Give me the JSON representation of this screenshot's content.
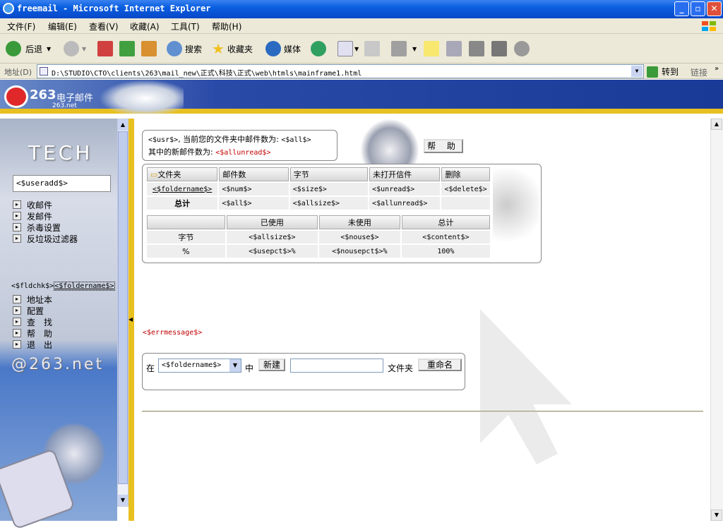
{
  "window": {
    "title": "freemail - Microsoft Internet Explorer"
  },
  "menu": [
    "文件(F)",
    "编辑(E)",
    "查看(V)",
    "收藏(A)",
    "工具(T)",
    "帮助(H)"
  ],
  "toolbar": {
    "back": "后退",
    "search": "搜索",
    "favorites": "收藏夹",
    "media": "媒体"
  },
  "address": {
    "label": "地址(D)",
    "url": "D:\\STUDIO\\CTO\\clients\\263\\mail_new\\正式\\科技\\正式\\web\\htmls\\mainframe1.html",
    "go": "转到",
    "links": "链接"
  },
  "brand": {
    "name": "263",
    "sub": "电子邮件",
    "site": "263.net"
  },
  "left": {
    "tech": "TECH",
    "useradd": "<$useradd$>",
    "nav1": [
      "收邮件",
      "发邮件",
      "杀毒设置",
      "反垃圾过滤器"
    ],
    "fldchk": "<$fldchk$>",
    "foldername": "<$foldername$>",
    "nav2": [
      "地址本",
      "配置",
      "查　找",
      "帮　助",
      "退　出"
    ],
    "footer": "@263.net"
  },
  "info": {
    "line1_var": "<$usr$>",
    "line1_text": ", 当前您的文件夹中邮件数为: ",
    "line1_all": "<$all$>",
    "line2_text": "其中的新邮件数为: ",
    "line2_unread": "<$allunread$>",
    "help": "帮 助"
  },
  "table1": {
    "headers": [
      "文件夹",
      "邮件数",
      "字节",
      "未打开信件",
      "删除"
    ],
    "row": [
      "<$foldername$>",
      "<$num$>",
      "<$size$>",
      "<$unread$>",
      "<$delete$>"
    ],
    "total": [
      "总计",
      "<$all$>",
      "<$allsize$>",
      "<$allunread$>",
      ""
    ]
  },
  "table2": {
    "headers": [
      "",
      "已使用",
      "未使用",
      "总计"
    ],
    "rows": [
      [
        "字节",
        "<$allsize$>",
        "<$nouse$>",
        "<$content$>"
      ],
      [
        "%",
        "<$usepct$>%",
        "<$nousepct$>%",
        "100%"
      ]
    ]
  },
  "errmessage": "<$errmessage$>",
  "folderform": {
    "in": "在",
    "select": "<$foldername$>",
    "middle": "中",
    "new": "新建",
    "input": "",
    "suffix": "文件夹",
    "rename": "重命名"
  },
  "colors": {
    "accent": "#e8c020",
    "titlebar": "#0a5ee0",
    "red": "#c00000"
  }
}
